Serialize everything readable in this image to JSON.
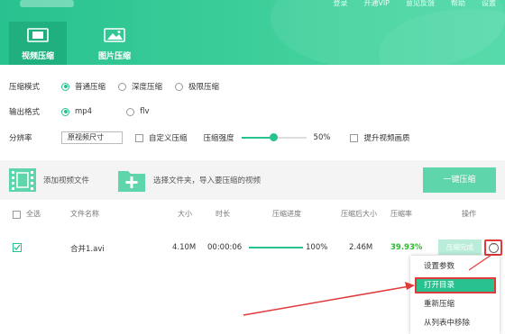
{
  "header": {
    "top_links": [
      "登录",
      "开通VIP",
      "意见反馈",
      "帮助",
      "设置"
    ],
    "tabs": [
      {
        "label": "视频压缩",
        "active": true
      },
      {
        "label": "图片压缩",
        "active": false
      }
    ]
  },
  "options": {
    "mode_label": "压缩模式",
    "modes": [
      "普通压缩",
      "深度压缩",
      "极限压缩"
    ],
    "mode_selected": "普通压缩",
    "format_label": "输出格式",
    "formats": [
      "mp4",
      "flv"
    ],
    "format_selected": "mp4",
    "resolution_label": "分辨率",
    "resolution_value": "原视频尺寸",
    "custom_compress_label": "自定义压缩",
    "strength_label": "压缩强度",
    "strength_value": "50%",
    "strength_fraction": 0.5,
    "enhance_label": "提升视频画质"
  },
  "addbar": {
    "add_video": "添加视频文件",
    "choose_folder": "选择文件夹，导入要压缩的视频",
    "compress_all": "一键压缩"
  },
  "table": {
    "headers": [
      "全选",
      "文件名称",
      "大小",
      "时长",
      "压缩进度",
      "压缩后大小",
      "压缩率",
      "操作"
    ],
    "rows": [
      {
        "checked": true,
        "name": "合并1.avi",
        "size": "4.10M",
        "duration": "00:00:06",
        "progress": "100%",
        "progress_fraction": 1.0,
        "compressed_size": "2.46M",
        "ratio": "39.93%",
        "action": "压缩完成"
      }
    ]
  },
  "context_menu": {
    "items": [
      "设置参数",
      "打开目录",
      "重新压缩",
      "从列表中移除"
    ],
    "highlighted": "打开目录"
  },
  "colors": {
    "accent": "#27c28f",
    "highlight_red": "#e03b3b",
    "ratio_green": "#2eb82e"
  }
}
